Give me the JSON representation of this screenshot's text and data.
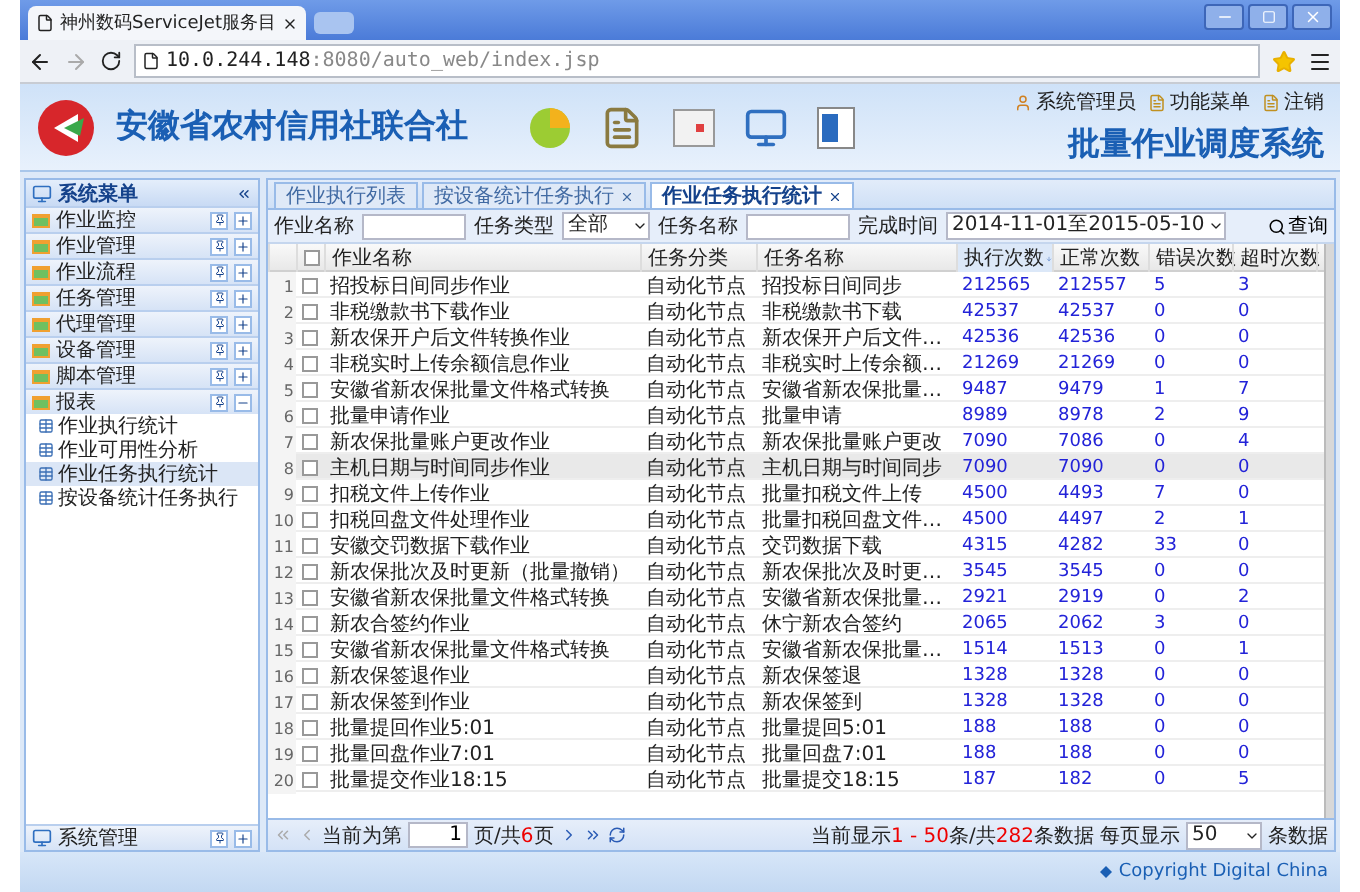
{
  "browser": {
    "tab_title": "神州数码ServiceJet服务目",
    "url_host": "10.0.244.148",
    "url_path": ":8080/auto_web/index.jsp"
  },
  "header": {
    "org_name": "安徽省农村信用社联合社",
    "user_links": [
      "系统管理员",
      "功能菜单",
      "注销"
    ],
    "system_title": "批量作业调度系统"
  },
  "sidebar": {
    "title": "系统菜单",
    "groups": [
      {
        "label": "作业监控",
        "expanded": false
      },
      {
        "label": "作业管理",
        "expanded": false
      },
      {
        "label": "作业流程",
        "expanded": false
      },
      {
        "label": "任务管理",
        "expanded": false
      },
      {
        "label": "代理管理",
        "expanded": false
      },
      {
        "label": "设备管理",
        "expanded": false
      },
      {
        "label": "脚本管理",
        "expanded": false
      },
      {
        "label": "报表",
        "expanded": true,
        "children": [
          {
            "label": "作业执行统计",
            "selected": false
          },
          {
            "label": "作业可用性分析",
            "selected": false
          },
          {
            "label": "作业任务执行统计",
            "selected": true
          },
          {
            "label": "按设备统计任务执行",
            "selected": false
          }
        ]
      }
    ],
    "bottom_group": {
      "label": "系统管理",
      "expanded": false
    }
  },
  "tabs": [
    {
      "label": "作业执行列表",
      "selected": false,
      "closable": false
    },
    {
      "label": "按设备统计任务执行",
      "selected": false,
      "closable": true
    },
    {
      "label": "作业任务执行统计",
      "selected": true,
      "closable": true
    }
  ],
  "filters": {
    "job_name_label": "作业名称",
    "task_type_label": "任务类型",
    "task_type_value": "全部",
    "task_name_label": "任务名称",
    "time_label": "完成时间",
    "time_value": "2014-11-01至2015-05-10",
    "search_button": "查询"
  },
  "table": {
    "select_all_checked": false,
    "columns": [
      {
        "label": "作业名称",
        "sorted": false
      },
      {
        "label": "任务分类",
        "sorted": false
      },
      {
        "label": "任务名称",
        "sorted": false
      },
      {
        "label": "执行次数",
        "sorted": true
      },
      {
        "label": "正常次数",
        "sorted": false
      },
      {
        "label": "错误次数",
        "sorted": false
      },
      {
        "label": "超时次数",
        "sorted": false
      }
    ],
    "rows": [
      {
        "index": "1",
        "selected": false,
        "checked": false,
        "cells": [
          "招投标日间同步作业",
          "自动化节点",
          "招投标日间同步",
          "212565",
          "212557",
          "5",
          "3"
        ]
      },
      {
        "index": "2",
        "selected": false,
        "checked": false,
        "cells": [
          "非税缴款书下载作业",
          "自动化节点",
          "非税缴款书下载",
          "42537",
          "42537",
          "0",
          "0"
        ]
      },
      {
        "index": "3",
        "selected": false,
        "checked": false,
        "cells": [
          "新农保开户后文件转换作业",
          "自动化节点",
          "新农保开户后文件…",
          "42536",
          "42536",
          "0",
          "0"
        ]
      },
      {
        "index": "4",
        "selected": false,
        "checked": false,
        "cells": [
          "非税实时上传余额信息作业",
          "自动化节点",
          "非税实时上传余额…",
          "21269",
          "21269",
          "0",
          "0"
        ]
      },
      {
        "index": "5",
        "selected": false,
        "checked": false,
        "cells": [
          "安徽省新农保批量文件格式转换",
          "自动化节点",
          "安徽省新农保批量…",
          "9487",
          "9479",
          "1",
          "7"
        ]
      },
      {
        "index": "6",
        "selected": false,
        "checked": false,
        "cells": [
          "批量申请作业",
          "自动化节点",
          "批量申请",
          "8989",
          "8978",
          "2",
          "9"
        ]
      },
      {
        "index": "7",
        "selected": false,
        "checked": false,
        "cells": [
          "新农保批量账户更改作业",
          "自动化节点",
          "新农保批量账户更改",
          "7090",
          "7086",
          "0",
          "4"
        ]
      },
      {
        "index": "8",
        "selected": true,
        "checked": false,
        "cells": [
          "主机日期与时间同步作业",
          "自动化节点",
          "主机日期与时间同步",
          "7090",
          "7090",
          "0",
          "0"
        ]
      },
      {
        "index": "9",
        "selected": false,
        "checked": false,
        "cells": [
          "扣税文件上传作业",
          "自动化节点",
          "批量扣税文件上传",
          "4500",
          "4493",
          "7",
          "0"
        ]
      },
      {
        "index": "10",
        "selected": false,
        "checked": false,
        "cells": [
          "扣税回盘文件处理作业",
          "自动化节点",
          "批量扣税回盘文件…",
          "4500",
          "4497",
          "2",
          "1"
        ]
      },
      {
        "index": "11",
        "selected": false,
        "checked": false,
        "cells": [
          "安徽交罚数据下载作业",
          "自动化节点",
          "交罚数据下载",
          "4315",
          "4282",
          "33",
          "0"
        ]
      },
      {
        "index": "12",
        "selected": false,
        "checked": false,
        "cells": [
          "新农保批次及时更新（批量撤销）",
          "自动化节点",
          "新农保批次及时更…",
          "3545",
          "3545",
          "0",
          "0"
        ]
      },
      {
        "index": "13",
        "selected": false,
        "checked": false,
        "cells": [
          "安徽省新农保批量文件格式转换",
          "自动化节点",
          "安徽省新农保批量…",
          "2921",
          "2919",
          "0",
          "2"
        ]
      },
      {
        "index": "14",
        "selected": false,
        "checked": false,
        "cells": [
          "新农合签约作业",
          "自动化节点",
          "休宁新农合签约",
          "2065",
          "2062",
          "3",
          "0"
        ]
      },
      {
        "index": "15",
        "selected": false,
        "checked": false,
        "cells": [
          "安徽省新农保批量文件格式转换",
          "自动化节点",
          "安徽省新农保批量…",
          "1514",
          "1513",
          "0",
          "1"
        ]
      },
      {
        "index": "16",
        "selected": false,
        "checked": false,
        "cells": [
          "新农保签退作业",
          "自动化节点",
          "新农保签退",
          "1328",
          "1328",
          "0",
          "0"
        ]
      },
      {
        "index": "17",
        "selected": false,
        "checked": false,
        "cells": [
          "新农保签到作业",
          "自动化节点",
          "新农保签到",
          "1328",
          "1328",
          "0",
          "0"
        ]
      },
      {
        "index": "18",
        "selected": false,
        "checked": false,
        "cells": [
          "批量提回作业5:01",
          "自动化节点",
          "批量提回5:01",
          "188",
          "188",
          "0",
          "0"
        ]
      },
      {
        "index": "19",
        "selected": false,
        "checked": false,
        "cells": [
          "批量回盘作业7:01",
          "自动化节点",
          "批量回盘7:01",
          "188",
          "188",
          "0",
          "0"
        ]
      },
      {
        "index": "20",
        "selected": false,
        "checked": false,
        "cells": [
          "批量提交作业18:15",
          "自动化节点",
          "批量提交18:15",
          "187",
          "182",
          "0",
          "5"
        ]
      }
    ]
  },
  "pager": {
    "prefix": "当前为第",
    "page": "1",
    "middle": "页/共",
    "total_pages": "6",
    "suffix": "页",
    "showing_prefix": "当前显示",
    "range": "1 - 50",
    "showing_middle": "条/共",
    "total": "282",
    "showing_suffix": "条数据",
    "per_page_label": "每页显示",
    "per_page": "50",
    "per_page_suffix": "条数据"
  },
  "footer": {
    "copyright": "Copyright Digital China"
  }
}
